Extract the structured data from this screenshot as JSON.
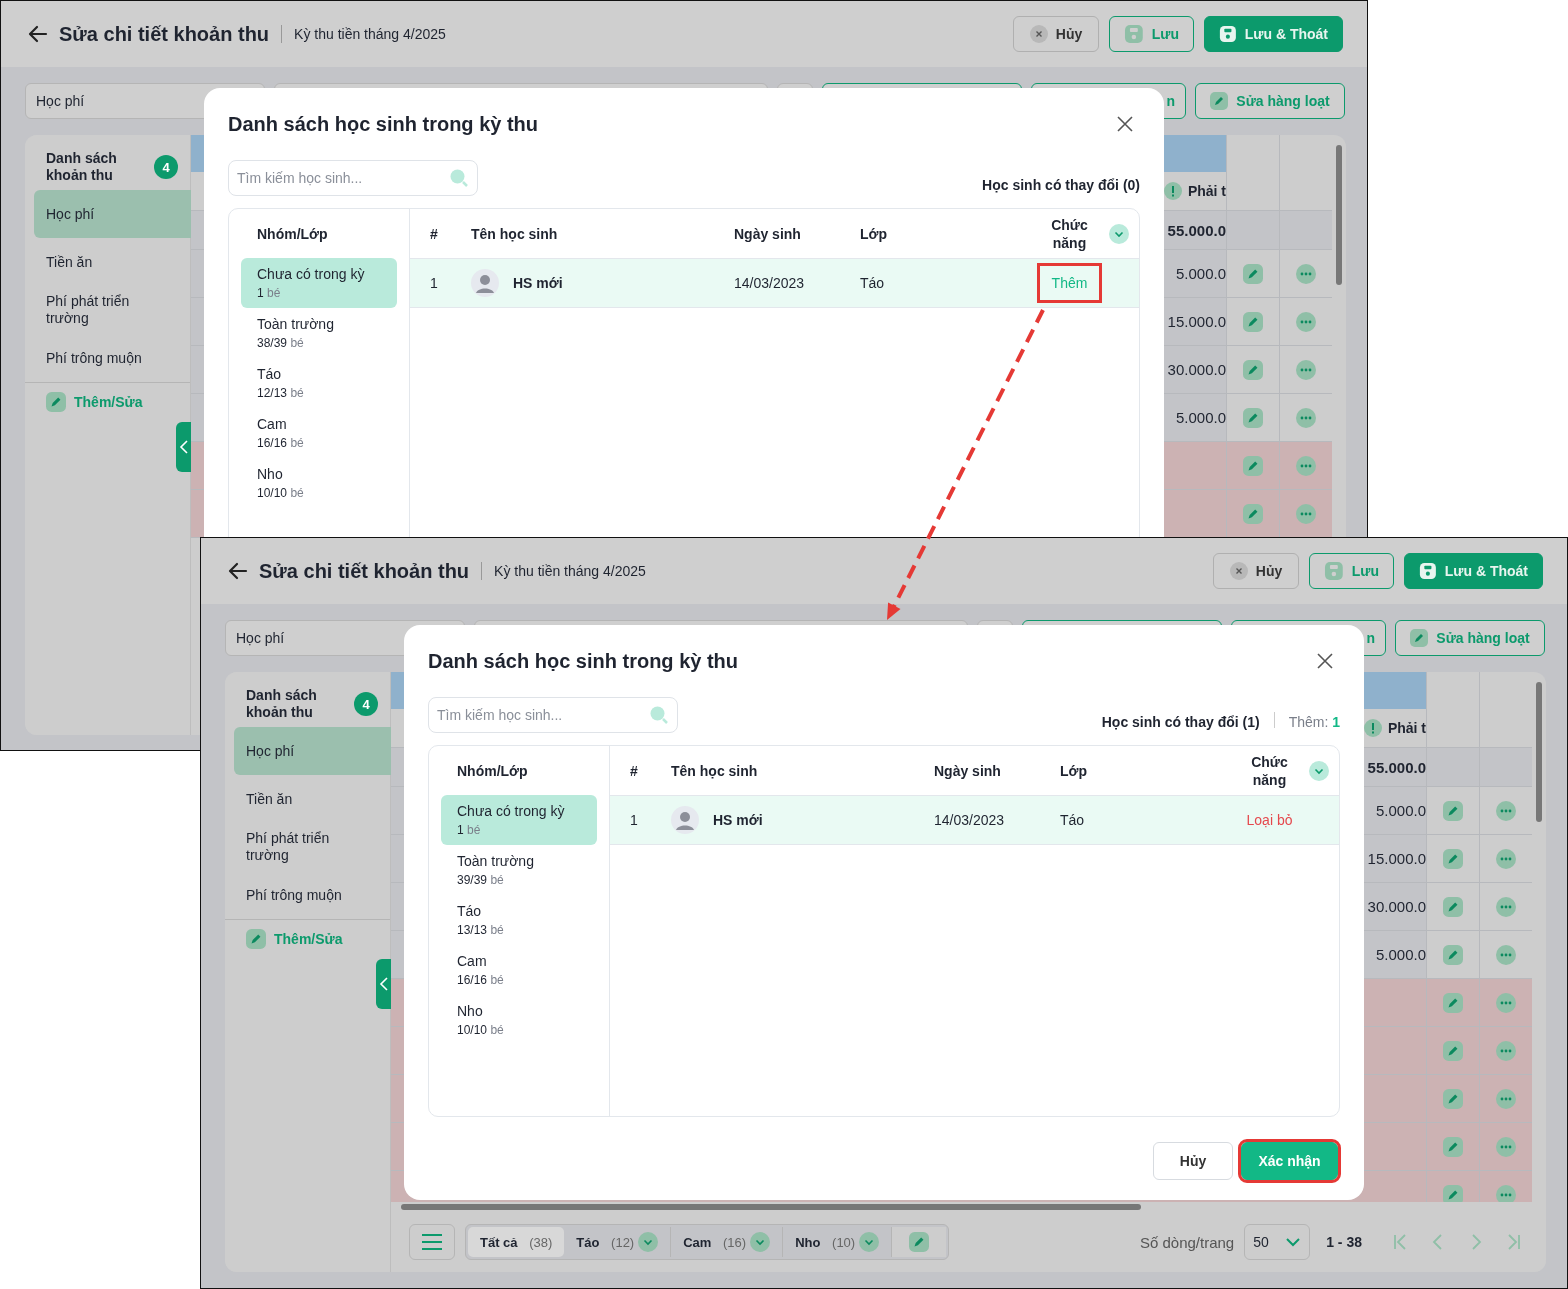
{
  "screens": [
    {
      "header": {
        "title": "Sửa chi tiết khoản thu",
        "period": "Kỳ thu tiền tháng 4/2025",
        "buttons": [
          {
            "label": "Hủy",
            "kind": "cancel"
          },
          {
            "label": "Lưu",
            "kind": "save"
          },
          {
            "label": "Lưu & Thoát",
            "kind": "primary"
          }
        ]
      },
      "filters": [
        {
          "kind": "select",
          "value": "Học phí"
        },
        {
          "kind": "field"
        },
        {
          "kind": "field"
        },
        {
          "kind": "outlined"
        },
        {
          "kind": "outlined",
          "value": "n"
        },
        {
          "kind": "bulk",
          "value": "Sửa hàng loạt"
        }
      ],
      "sidebar": {
        "title": "Danh sách khoản thu",
        "count": "4",
        "items": [
          {
            "label": "Học phí",
            "selected": true
          },
          {
            "label": "Tiền ăn",
            "selected": false
          },
          {
            "label": "Phí phát triển trường",
            "selected": false
          },
          {
            "label": "Phí trông muộn",
            "selected": false
          }
        ],
        "add_edit": "Thêm/Sửa"
      },
      "table": {
        "header": "Phải t",
        "total": "55.000.0",
        "rows": [
          {
            "amount": "5.000.0",
            "flagged": false
          },
          {
            "amount": "15.000.0",
            "flagged": false
          },
          {
            "amount": "30.000.0",
            "flagged": false
          },
          {
            "amount": "5.000.0",
            "flagged": false
          },
          {
            "flagged": true
          },
          {
            "flagged": true
          }
        ]
      },
      "dialog": {
        "title": "Danh sách học sinh trong kỳ thu",
        "search_placeholder": "Tìm kiếm học sinh...",
        "changes": "Học sinh có thay đổi (0)",
        "group_header": "Nhóm/Lớp",
        "groups": [
          {
            "name": "Chưa có trong kỳ",
            "count": "1",
            "unit": "bé",
            "selected": true
          },
          {
            "name": "Toàn trường",
            "count": "38/39",
            "unit": "bé",
            "selected": false
          },
          {
            "name": "Táo",
            "count": "12/13",
            "unit": "bé",
            "selected": false
          },
          {
            "name": "Cam",
            "count": "16/16",
            "unit": "bé",
            "selected": false
          },
          {
            "name": "Nho",
            "count": "10/10",
            "unit": "bé",
            "selected": false
          }
        ],
        "columns": [
          "#",
          "Tên học sinh",
          "Ngày sinh",
          "Lớp",
          "Chức năng"
        ],
        "rows": [
          {
            "index": "1",
            "name": "HS mới",
            "birthday": "14/03/2023",
            "class": "Táo",
            "action": "Thêm",
            "kind": "add",
            "highlighted": true
          }
        ]
      }
    },
    {
      "header": {
        "title": "Sửa chi tiết khoản thu",
        "period": "Kỳ thu tiền tháng 4/2025",
        "buttons": [
          {
            "label": "Hủy",
            "kind": "cancel"
          },
          {
            "label": "Lưu",
            "kind": "save"
          },
          {
            "label": "Lưu & Thoát",
            "kind": "primary"
          }
        ]
      },
      "filters": [
        {
          "kind": "select",
          "value": "Học phí"
        },
        {
          "kind": "field"
        },
        {
          "kind": "field"
        },
        {
          "kind": "outlined"
        },
        {
          "kind": "outlined",
          "value": "n"
        },
        {
          "kind": "bulk",
          "value": "Sửa hàng loạt"
        }
      ],
      "sidebar": {
        "title": "Danh sách khoản thu",
        "count": "4",
        "items": [
          {
            "label": "Học phí",
            "selected": true
          },
          {
            "label": "Tiền ăn",
            "selected": false
          },
          {
            "label": "Phí phát triển trường",
            "selected": false
          },
          {
            "label": "Phí trông muộn",
            "selected": false
          }
        ],
        "add_edit": "Thêm/Sửa"
      },
      "table": {
        "header": "Phải t",
        "total": "55.000.0",
        "rows": [
          {
            "amount": "5.000.0",
            "flagged": false
          },
          {
            "amount": "15.000.0",
            "flagged": false
          },
          {
            "amount": "30.000.0",
            "flagged": false
          },
          {
            "amount": "5.000.0",
            "flagged": false
          },
          {
            "flagged": true
          },
          {
            "flagged": true
          },
          {
            "flagged": true
          },
          {
            "flagged": true
          },
          {
            "flagged": true
          }
        ]
      },
      "footer": {
        "tabs": [
          {
            "label": "Tất cả",
            "count": "(38)",
            "selected": true,
            "dropdown": false
          },
          {
            "label": "Táo",
            "count": "(12)",
            "selected": false,
            "dropdown": true
          },
          {
            "label": "Cam",
            "count": "(16)",
            "selected": false,
            "dropdown": true
          },
          {
            "label": "Nho",
            "count": "(10)",
            "selected": false,
            "dropdown": true
          }
        ],
        "rows_label": "Số dòng/trang",
        "page_size": "50",
        "range": "1 - 38"
      },
      "dialog": {
        "title": "Danh sách học sinh trong kỳ thu",
        "search_placeholder": "Tìm kiếm học sinh...",
        "changes": "Học sinh có thay đổi (1)",
        "added": {
          "label": "Thêm:",
          "count": "1"
        },
        "group_header": "Nhóm/Lớp",
        "groups": [
          {
            "name": "Chưa có trong kỳ",
            "count": "1",
            "unit": "bé",
            "selected": true
          },
          {
            "name": "Toàn trường",
            "count": "39/39",
            "unit": "bé",
            "selected": false
          },
          {
            "name": "Táo",
            "count": "13/13",
            "unit": "bé",
            "selected": false
          },
          {
            "name": "Cam",
            "count": "16/16",
            "unit": "bé",
            "selected": false
          },
          {
            "name": "Nho",
            "count": "10/10",
            "unit": "bé",
            "selected": false
          }
        ],
        "columns": [
          "#",
          "Tên học sinh",
          "Ngày sinh",
          "Lớp",
          "Chức năng"
        ],
        "rows": [
          {
            "index": "1",
            "name": "HS mới",
            "birthday": "14/03/2023",
            "class": "Táo",
            "action": "Loại bỏ",
            "kind": "remove",
            "highlighted": false
          }
        ],
        "buttons": [
          {
            "label": "Hủy",
            "kind": "cancel",
            "highlighted": false
          },
          {
            "label": "Xác nhận",
            "kind": "confirm",
            "highlighted": true
          }
        ]
      }
    }
  ]
}
